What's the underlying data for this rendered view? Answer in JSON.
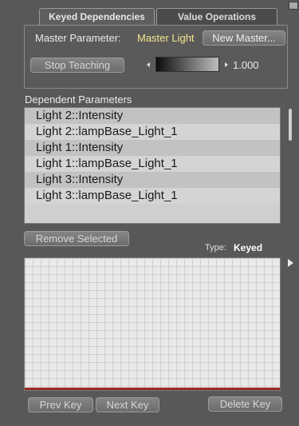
{
  "tabs": [
    {
      "label": "Keyed Dependencies",
      "active": true
    },
    {
      "label": "Value Operations",
      "active": false
    }
  ],
  "master": {
    "label": "Master Parameter:",
    "value": "Master Light",
    "new_button": "New Master..."
  },
  "teaching": {
    "stop_button": "Stop Teaching",
    "dial_value": "1.000"
  },
  "dependent": {
    "label": "Dependent Parameters",
    "items": [
      "Light 2::Intensity",
      "Light 2::lampBase_Light_1",
      "Light 1::Intensity",
      "Light 1::lampBase_Light_1",
      "Light 3::Intensity",
      "Light 3::lampBase_Light_1"
    ],
    "remove_button": "Remove Selected"
  },
  "graph": {
    "type_label": "Type:",
    "type_value": "Keyed"
  },
  "keys": {
    "prev": "Prev Key",
    "next": "Next Key",
    "delete": "Delete Key"
  },
  "colors": {
    "panel_bg": "#585858",
    "master_value": "#f3e68c",
    "list_bg": "#cfcfcf",
    "graph_bg": "#e9e9e9",
    "graph_baseline": "#9a2a22"
  }
}
